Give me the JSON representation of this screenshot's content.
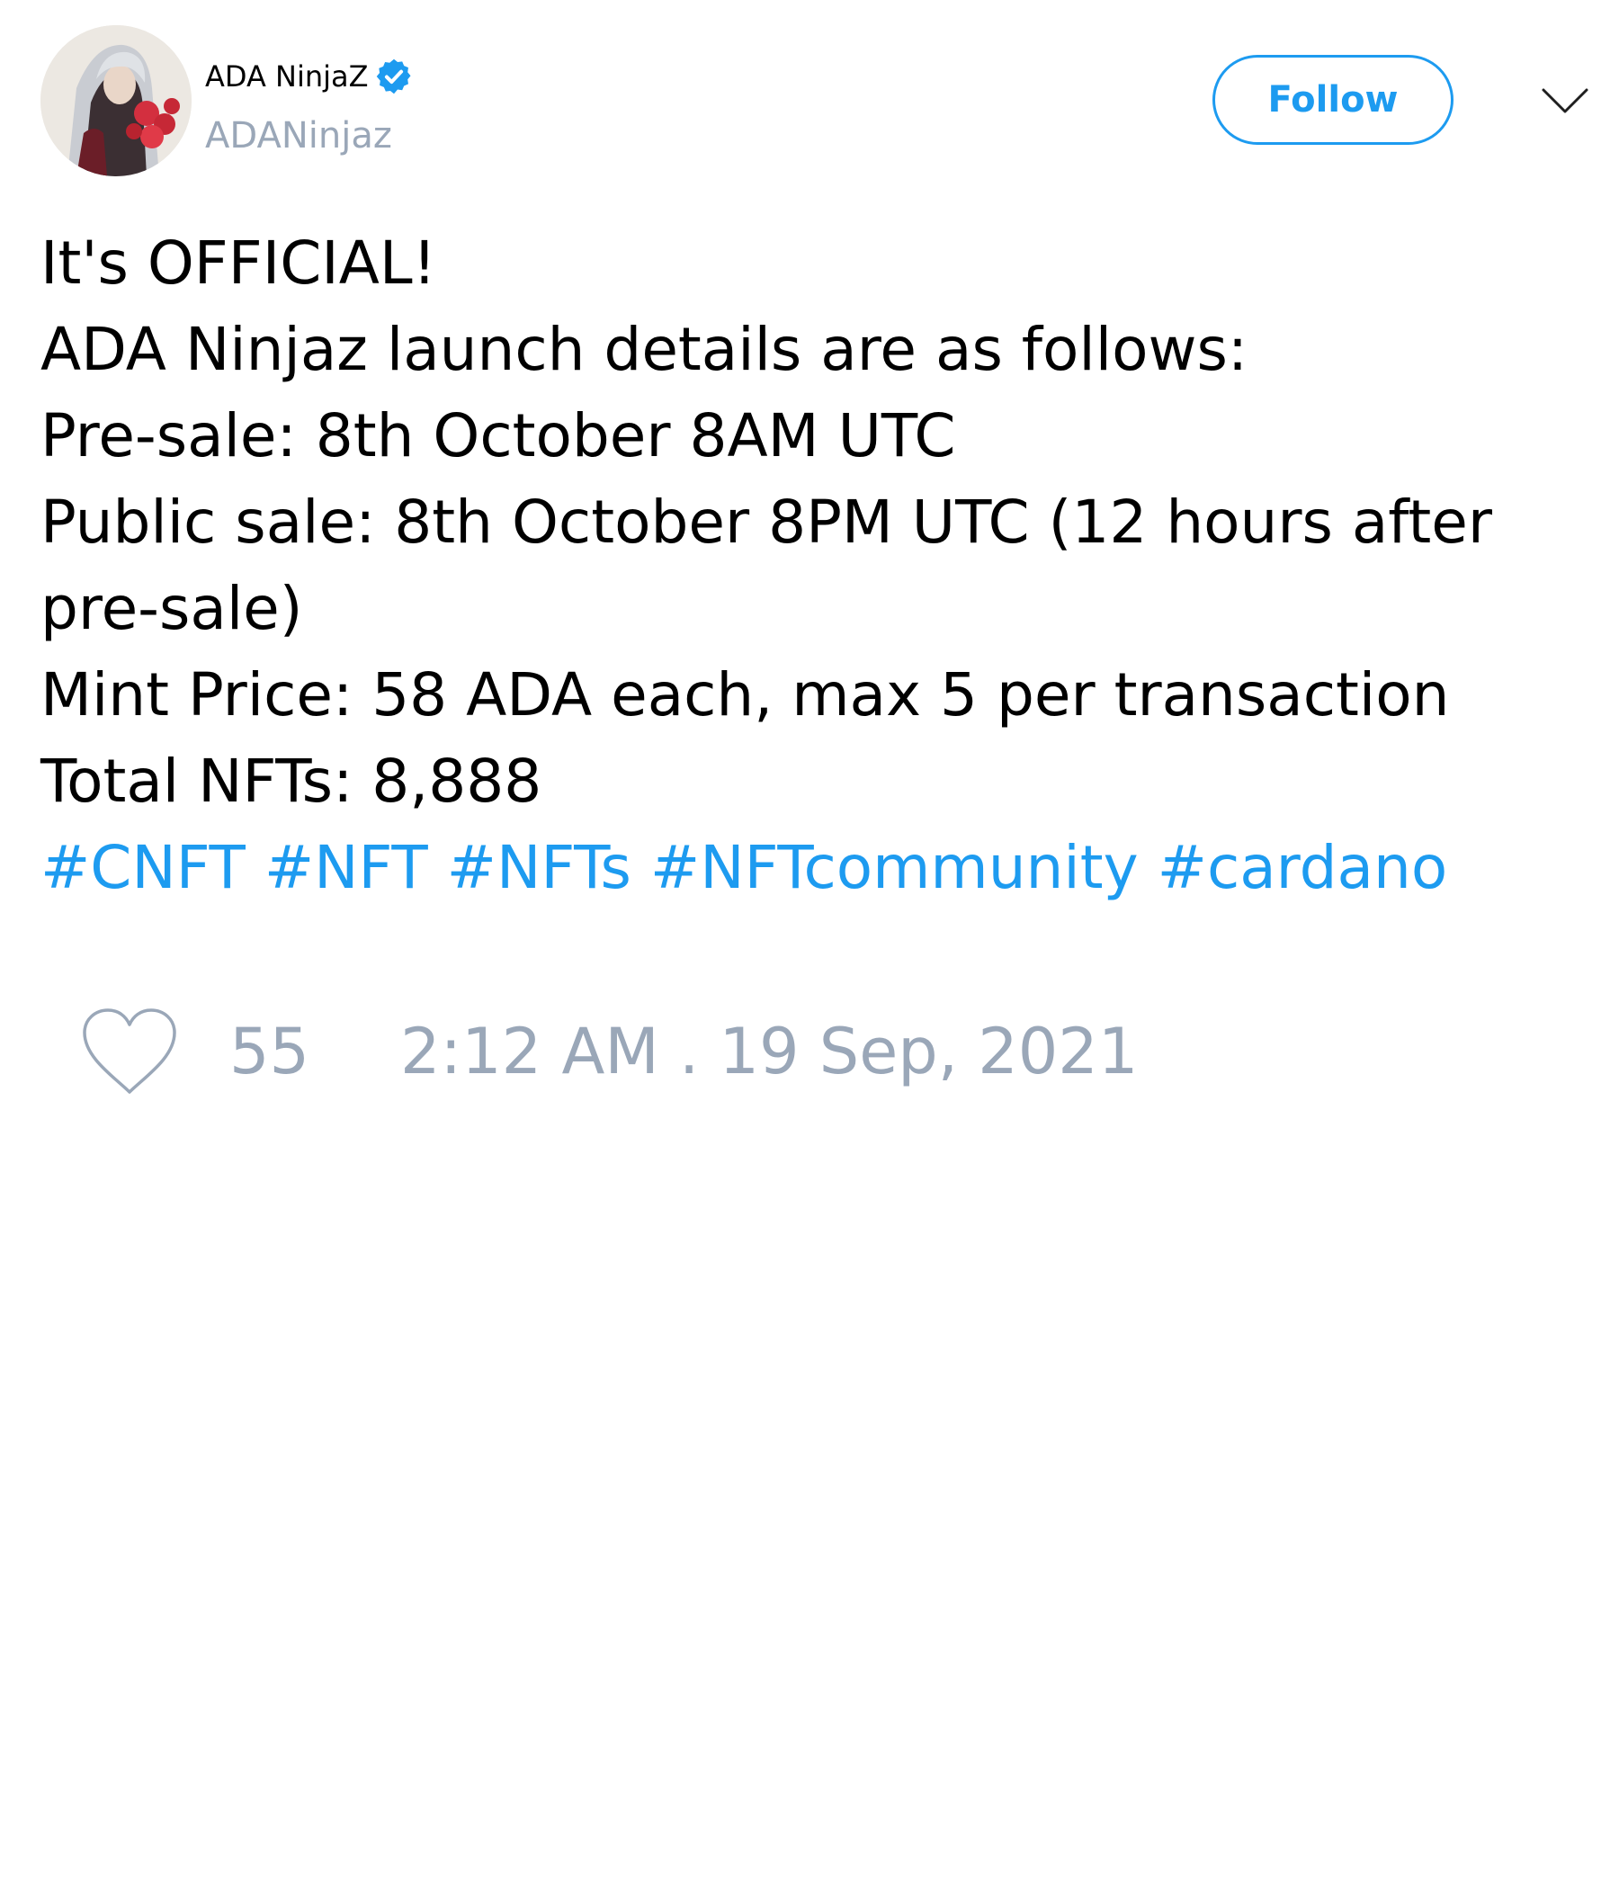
{
  "tweet": {
    "author": {
      "display_name": "ADA NinjaZ",
      "handle": "ADANinjaz",
      "verified": true
    },
    "follow_label": "Follow",
    "lines": [
      "It's OFFICIAL!",
      "ADA Ninjaz launch details are as follows:",
      "Pre-sale: 8th October 8AM UTC",
      "Public sale: 8th October 8PM UTC (12 hours after",
      "pre-sale)",
      "Mint Price: 58 ADA each, max 5 per transaction",
      "Total NFTs: 8,888"
    ],
    "hashtags": [
      "#CNFT",
      "#NFT",
      "#NFTs",
      "#NFTcommunity",
      "#cardano"
    ],
    "like_count": "55",
    "timestamp": "2:12 AM . 19 Sep, 2021"
  },
  "icons": {
    "verified": "verified-badge-icon",
    "menu": "chevron-down-icon",
    "like": "heart-outline-icon"
  },
  "colors": {
    "accent": "#1d9bf0",
    "muted": "#9aa7b8",
    "text": "#000000",
    "background": "#ffffff"
  }
}
